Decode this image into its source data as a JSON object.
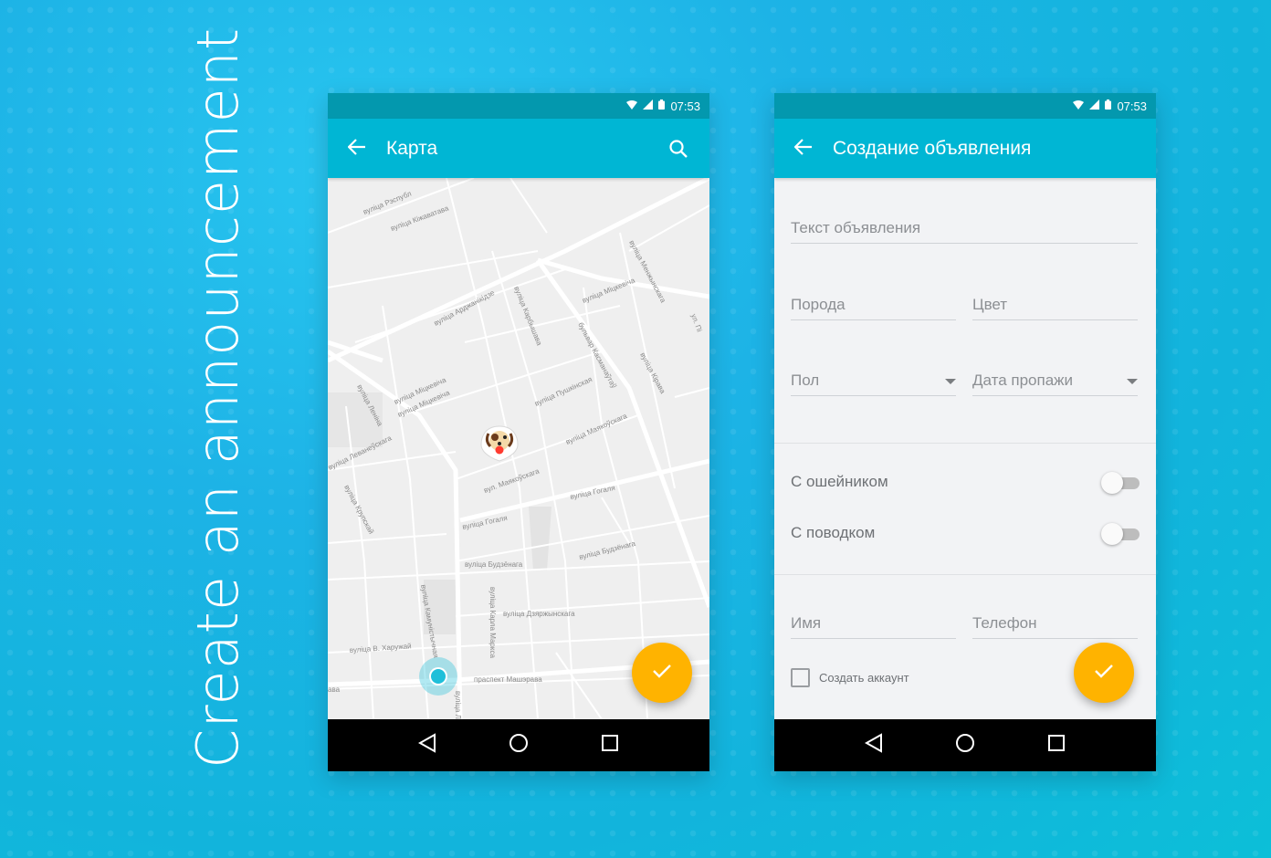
{
  "side_title": "Create an announcement",
  "map_screen": {
    "status": {
      "time": "07:53",
      "icons": [
        "wifi-icon",
        "signal-icon",
        "battery-icon"
      ]
    },
    "appbar": {
      "title": "Карта",
      "back_icon": "arrow-back-icon",
      "search_icon": "search-icon"
    },
    "streets": [
      "вуліца Рэспубл",
      "вуліца Кіжаватава",
      "вуліца Арджанікідзе",
      "вуліца Карбышава",
      "вуліца Міцкевіча",
      "вуліца Менжынскага",
      "бульвар Касманаўтаў",
      "вуліца Кірава",
      "вуліца Пушкінская",
      "вуліца Маякоўскага",
      "вул. Маякоўскага",
      "вуліца Леніна",
      "вуліца Міцкевіча",
      "вуліца Міцкевіча",
      "вуліца Леванеўскага",
      "вуліца Крупскай",
      "вуліца Гогаля",
      "вуліца Гогаля",
      "вуліца Будзёнага",
      "вуліца Будзёнага",
      "вуліца Дзяржынскага",
      "вуліца Карла Маркса",
      "вуліца Камуністычная",
      "вуліца В. Харужай",
      "праспект Машэрава",
      "ул. Пі",
      "вуліца Ле",
      "ава"
    ],
    "fab_icon": "check-icon",
    "nav": [
      "back-nav-icon",
      "home-nav-icon",
      "recents-nav-icon"
    ]
  },
  "form_screen": {
    "status": {
      "time": "07:53",
      "icons": [
        "wifi-icon",
        "signal-icon",
        "battery-icon"
      ]
    },
    "appbar": {
      "title": "Создание объявления",
      "back_icon": "arrow-back-icon"
    },
    "fields": {
      "text": "Текст объявления",
      "breed": "Порода",
      "color": "Цвет",
      "sex": "Пол",
      "lost_date": "Дата пропажи",
      "name": "Имя",
      "phone": "Телефон"
    },
    "toggles": {
      "collar": {
        "label": "С ошейником",
        "on": false
      },
      "leash": {
        "label": "С поводком",
        "on": false
      }
    },
    "create_account": {
      "label": "Создать аккаунт",
      "checked": false
    },
    "fab_icon": "check-icon",
    "nav": [
      "back-nav-icon",
      "home-nav-icon",
      "recents-nav-icon"
    ]
  },
  "colors": {
    "status_bar": "#0398ae",
    "app_bar": "#00b6d4",
    "fab": "#ffb300",
    "location_dot": "#1fbfd9",
    "pin_dot": "#ff3b30"
  }
}
